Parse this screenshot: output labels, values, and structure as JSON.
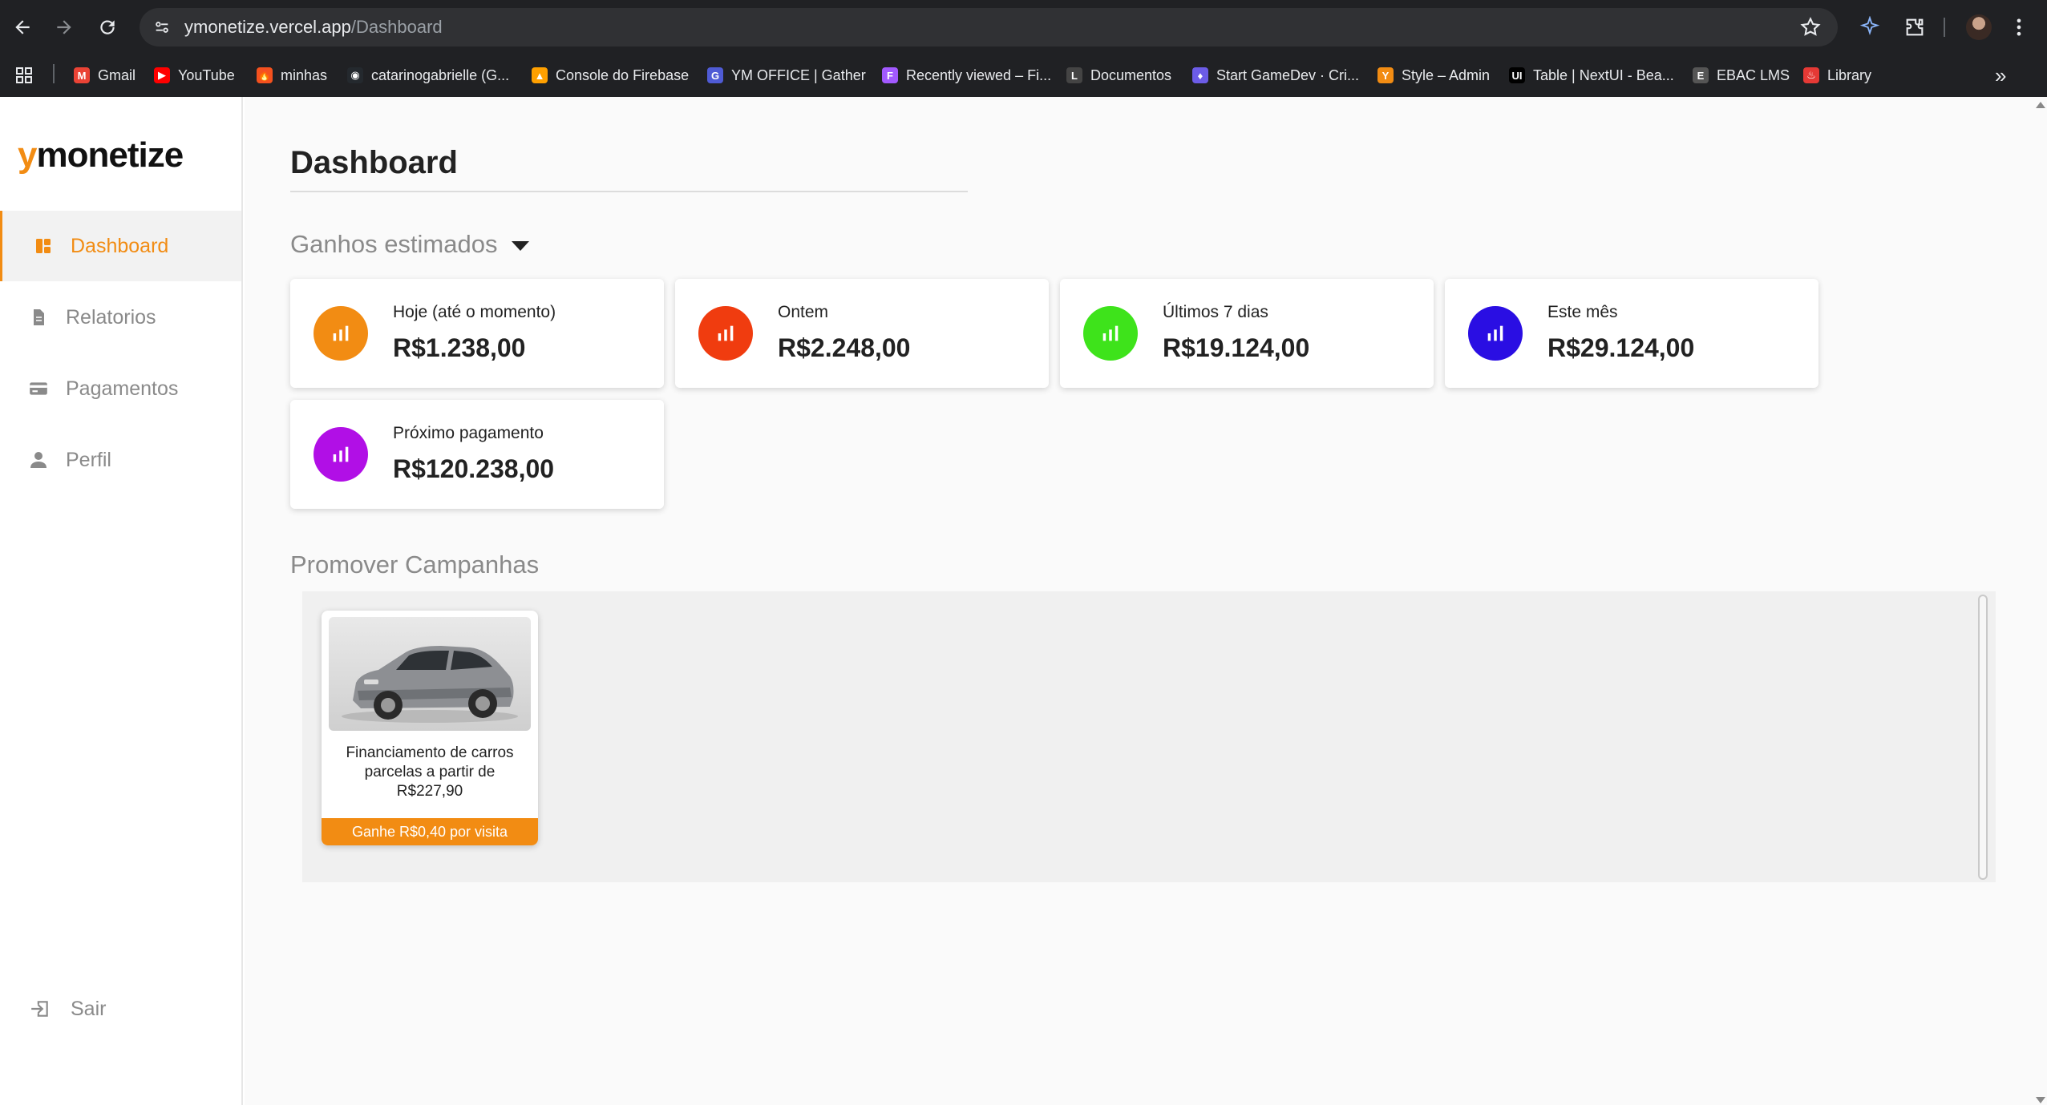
{
  "browser": {
    "url_host": "ymonetize.vercel.app",
    "url_path": "/Dashboard",
    "bookmarks": [
      {
        "label": "Gmail",
        "color": "#ea4335",
        "glyph": "M"
      },
      {
        "label": "YouTube",
        "color": "#ff0000",
        "glyph": "▶"
      },
      {
        "label": "minhas",
        "color": "#f4511e",
        "glyph": "🔥"
      },
      {
        "label": "catarinogabrielle (G...",
        "color": "#24292e",
        "glyph": "◉"
      },
      {
        "label": "Console do Firebase",
        "color": "#ffa000",
        "glyph": "▲"
      },
      {
        "label": "YM OFFICE | Gather",
        "color": "#4f5bd5",
        "glyph": "G"
      },
      {
        "label": "Recently viewed – Fi...",
        "color": "#a259ff",
        "glyph": "F"
      },
      {
        "label": "Documentos",
        "color": "#444444",
        "glyph": "L"
      },
      {
        "label": "Start GameDev · Cri...",
        "color": "#6c5ce7",
        "glyph": "♦"
      },
      {
        "label": "Style – Admin",
        "color": "#f28c13",
        "glyph": "Y"
      },
      {
        "label": "Table | NextUI - Bea...",
        "color": "#000000",
        "glyph": "UI"
      },
      {
        "label": "EBAC LMS",
        "color": "#555555",
        "glyph": "E"
      },
      {
        "label": "Library",
        "color": "#e53935",
        "glyph": "♨"
      }
    ]
  },
  "logo": {
    "y": "y",
    "rest": "monetize"
  },
  "sidebar": {
    "items": [
      {
        "label": "Dashboard",
        "icon": "dashboard-icon"
      },
      {
        "label": "Relatorios",
        "icon": "document-icon"
      },
      {
        "label": "Pagamentos",
        "icon": "payment-card-icon"
      },
      {
        "label": "Perfil",
        "icon": "user-icon"
      }
    ],
    "logout": "Sair"
  },
  "main": {
    "title": "Dashboard",
    "earnings_title": "Ganhos estimados",
    "cards": [
      {
        "label": "Hoje (até o momento)",
        "value": "R$1.238,00",
        "color": "#f28c13"
      },
      {
        "label": "Ontem",
        "value": "R$2.248,00",
        "color": "#f03c0f"
      },
      {
        "label": "Últimos 7 dias",
        "value": "R$19.124,00",
        "color": "#3ee31b"
      },
      {
        "label": "Este mês",
        "value": "R$29.124,00",
        "color": "#2a0ee3"
      },
      {
        "label": "Próximo pagamento",
        "value": "R$120.238,00",
        "color": "#b10fe6"
      }
    ],
    "campaigns_title": "Promover Campanhas",
    "campaign": {
      "text": "Financiamento de carros parcelas a partir de R$227,90",
      "button": "Ganhe R$0,40 por visita"
    }
  },
  "colors": {
    "accent": "#f28c13"
  }
}
